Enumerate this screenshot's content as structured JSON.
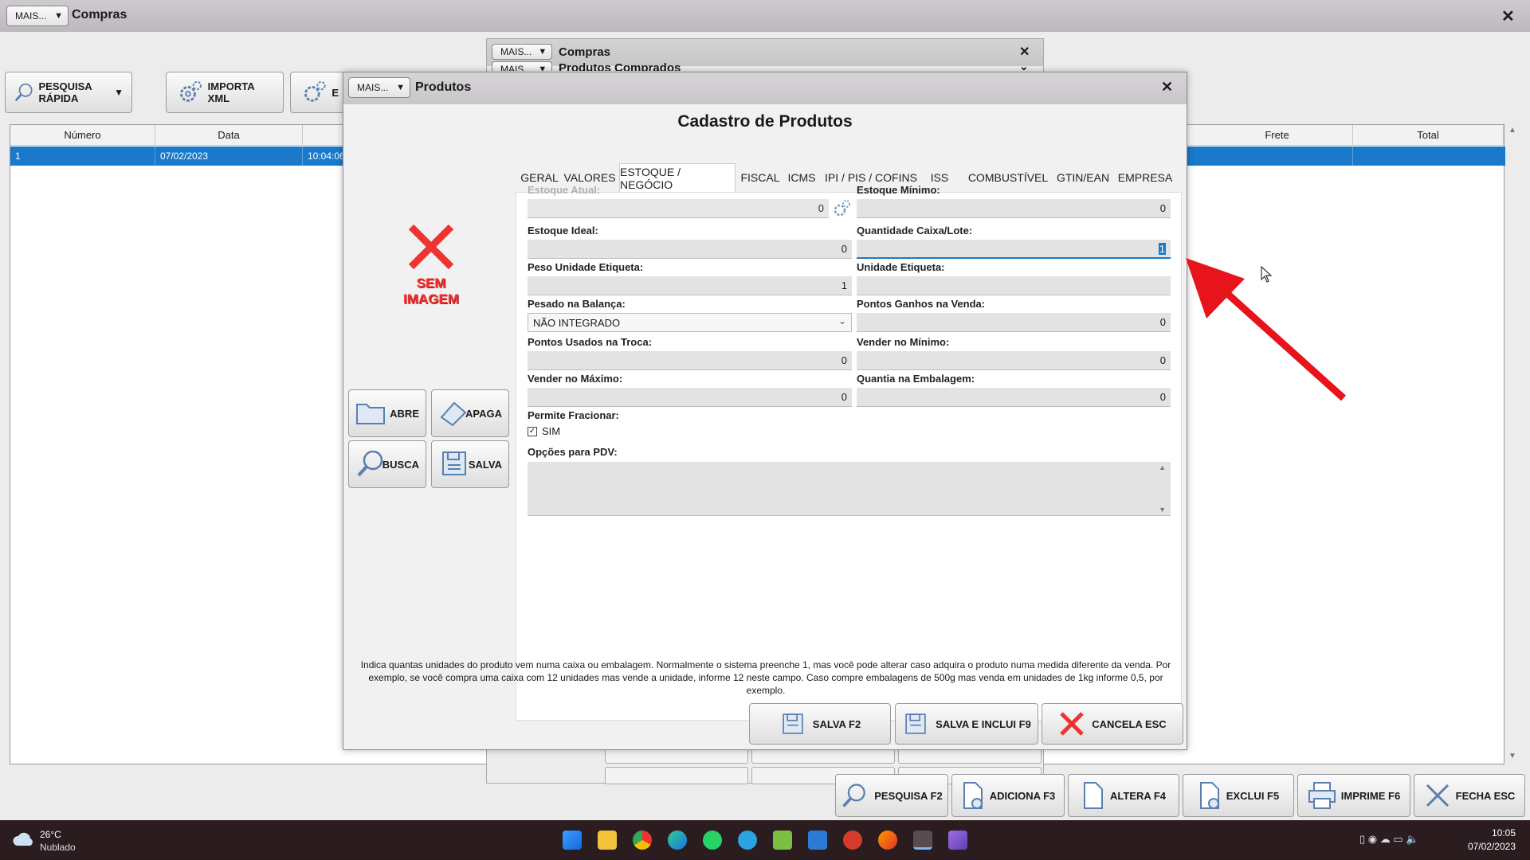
{
  "main": {
    "mais_label": "MAIS...",
    "title": "Compras",
    "toolbar": {
      "pesquisa_rapida": "PESQUISA RÁPIDA",
      "importa_xml": "IMPORTA XML",
      "partial_label": "E"
    },
    "grid": {
      "columns": [
        "Número",
        "Data",
        "Frete",
        "Total"
      ],
      "row": {
        "numero": "1",
        "data": "07/02/2023",
        "hora": "10:04:06"
      }
    },
    "bottom_buttons": {
      "pesquisa": "PESQUISA F2",
      "adiciona": "ADICIONA F3",
      "altera": "ALTERA F4",
      "exclui": "EXCLUI F5",
      "imprime": "IMPRIME F6",
      "fecha": "FECHA ESC"
    }
  },
  "compras_window": {
    "mais_label": "MAIS...",
    "title": "Compras",
    "sub_title": "Produtos Comprados"
  },
  "produtos": {
    "mais_label": "MAIS...",
    "title": "Produtos",
    "heading": "Cadastro de Produtos",
    "no_image_line1": "SEM",
    "no_image_line2": "IMAGEM",
    "side_buttons": {
      "abre": "ABRE",
      "apaga": "APAGA",
      "busca": "BUSCA",
      "salva": "SALVA"
    },
    "tabs": [
      "GERAL",
      "VALORES",
      "ESTOQUE / NEGÓCIO",
      "FISCAL",
      "ICMS",
      "IPI / PIS / COFINS",
      "ISS",
      "COMBUSTÍVEL",
      "GTIN/EAN",
      "EMPRESA"
    ],
    "active_tab": "ESTOQUE / NEGÓCIO",
    "fields": {
      "estoque_atual": {
        "label": "Estoque Atual:",
        "value": "0"
      },
      "estoque_minimo": {
        "label": "Estoque Mínimo:",
        "value": "0"
      },
      "estoque_ideal": {
        "label": "Estoque Ideal:",
        "value": "0"
      },
      "qtd_caixa": {
        "label": "Quantidade Caixa/Lote:",
        "value": "1"
      },
      "peso_unidade": {
        "label": "Peso Unidade Etiqueta:",
        "value": "1"
      },
      "unidade_etiqueta": {
        "label": "Unidade Etiqueta:",
        "value": ""
      },
      "pesado_balanca": {
        "label": "Pesado na Balança:",
        "value": "NÃO INTEGRADO"
      },
      "pontos_ganhos": {
        "label": "Pontos Ganhos na Venda:",
        "value": "0"
      },
      "pontos_usados": {
        "label": "Pontos Usados na Troca:",
        "value": "0"
      },
      "vender_minimo": {
        "label": "Vender no Mínimo:",
        "value": "0"
      },
      "vender_maximo": {
        "label": "Vender no Máximo:",
        "value": "0"
      },
      "quantia_embalagem": {
        "label": "Quantia na Embalagem:",
        "value": "0"
      },
      "permite_fracionar": {
        "label": "Permite Fracionar:",
        "option": "SIM",
        "checked": true
      },
      "opcoes_pdv": {
        "label": "Opções para PDV:"
      }
    },
    "help_text": "Indica quantas unidades do produto vem numa caixa ou embalagem. Normalmente o sistema preenche 1, mas você pode alterar caso adquira o produto numa medida diferente da venda. Por exemplo, se você compra uma caixa com 12 unidades mas vende a unidade, informe 12 neste campo. Caso compre embalagens de 500g mas venda em unidades de 1kg informe 0,5, por exemplo.",
    "footer_buttons": {
      "salva": "SALVA F2",
      "salva_inclui": "SALVA E INCLUI F9",
      "cancela": "CANCELA ESC"
    }
  },
  "taskbar": {
    "temperature": "26°C",
    "weather": "Nublado",
    "time": "10:05",
    "date": "07/02/2023"
  },
  "colors": {
    "selection": "#1979ca",
    "arrow": "#e8141b",
    "taskbar": "#2b1d1f"
  }
}
